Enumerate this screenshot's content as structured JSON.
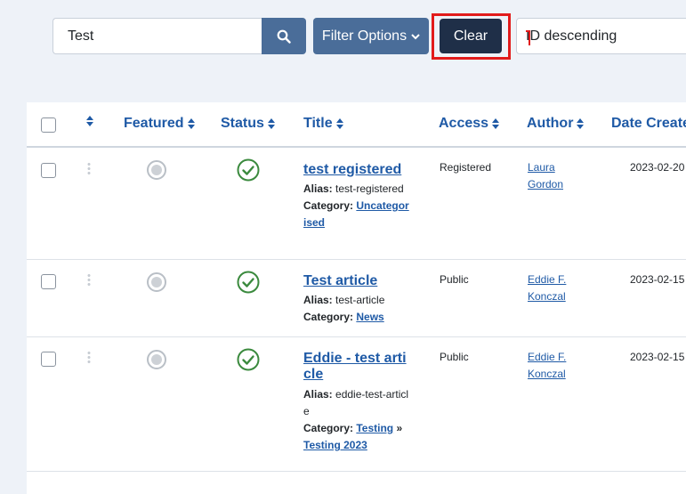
{
  "toolbar": {
    "search_value": "Test",
    "filter_label": "Filter Options",
    "clear_label": "Clear",
    "sort_value": "ID descending"
  },
  "colors": {
    "primary": "#4a6d99",
    "dark": "#1f2f48",
    "link": "#1f5aa6",
    "highlight": "#e21b1b",
    "published": "#3b8a3e"
  },
  "table": {
    "headers": {
      "featured": "Featured",
      "status": "Status",
      "title": "Title",
      "access": "Access",
      "author": "Author",
      "date": "Date Created"
    },
    "rows": [
      {
        "title": "test registered",
        "alias_label": "Alias:",
        "alias": "test-registered",
        "category_label": "Category:",
        "category": "Uncategorised",
        "category_sub": "",
        "access": "Registered",
        "author": "Laura Gordon",
        "date": "2023-02-20"
      },
      {
        "title": "Test article",
        "alias_label": "Alias:",
        "alias": "test-article",
        "category_label": "Category:",
        "category": "News",
        "category_sub": "",
        "access": "Public",
        "author": "Eddie F. Konczal",
        "date": "2023-02-15"
      },
      {
        "title": "Eddie - test article",
        "alias_label": "Alias:",
        "alias": "eddie-test-article",
        "category_label": "Category:",
        "category": "Testing",
        "category_sep": "»",
        "category_sub": "Testing 2023",
        "access": "Public",
        "author": "Eddie F. Konczal",
        "date": "2023-02-15"
      }
    ]
  }
}
